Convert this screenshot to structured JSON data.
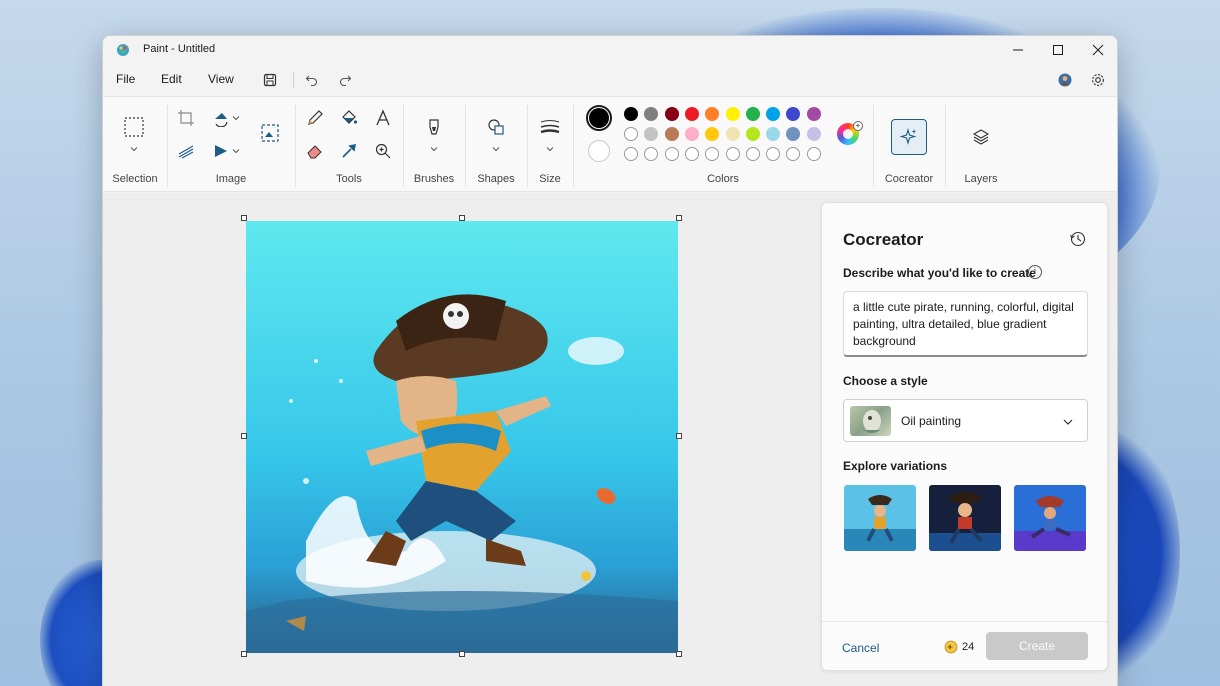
{
  "window": {
    "title": "Paint - Untitled"
  },
  "menu": {
    "file": "File",
    "edit": "Edit",
    "view": "View"
  },
  "ribbon": {
    "groups": {
      "selection": "Selection",
      "image": "Image",
      "tools": "Tools",
      "brushes": "Brushes",
      "shapes": "Shapes",
      "size": "Size",
      "colors": "Colors",
      "cocreator": "Cocreator",
      "layers": "Layers"
    },
    "palette_row1": [
      "#000000",
      "#7f7f7f",
      "#880015",
      "#ed1c24",
      "#ff7f27",
      "#fff200",
      "#22b14c",
      "#00a2e8",
      "#3f48cc",
      "#a349a4"
    ],
    "palette_row2": [
      "#ffffff",
      "#c3c3c3",
      "#b97a57",
      "#ffaec9",
      "#ffc90e",
      "#efe4b0",
      "#b5e61d",
      "#99d9ea",
      "#7092be",
      "#c8bfe7"
    ],
    "primary_color": "#000000",
    "secondary_color": "#ffffff"
  },
  "cocreator_panel": {
    "title": "Cocreator",
    "describe_label": "Describe what you'd like to create",
    "prompt_text": "a little cute pirate, running, colorful, digital painting, ultra detailed, blue gradient background",
    "style_label": "Choose a style",
    "selected_style": "Oil painting",
    "variations_label": "Explore variations",
    "cancel_label": "Cancel",
    "credits": "24",
    "create_label": "Create"
  }
}
